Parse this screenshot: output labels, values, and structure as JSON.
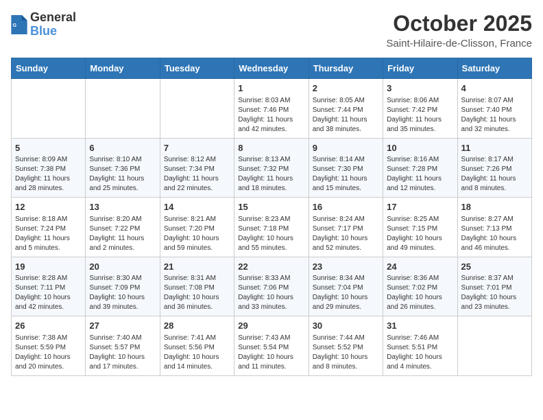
{
  "header": {
    "logo_general": "General",
    "logo_blue": "Blue",
    "month_title": "October 2025",
    "location": "Saint-Hilaire-de-Clisson, France"
  },
  "calendar": {
    "days_of_week": [
      "Sunday",
      "Monday",
      "Tuesday",
      "Wednesday",
      "Thursday",
      "Friday",
      "Saturday"
    ],
    "weeks": [
      [
        {
          "day": "",
          "info": ""
        },
        {
          "day": "",
          "info": ""
        },
        {
          "day": "",
          "info": ""
        },
        {
          "day": "1",
          "info": "Sunrise: 8:03 AM\nSunset: 7:46 PM\nDaylight: 11 hours\nand 42 minutes."
        },
        {
          "day": "2",
          "info": "Sunrise: 8:05 AM\nSunset: 7:44 PM\nDaylight: 11 hours\nand 38 minutes."
        },
        {
          "day": "3",
          "info": "Sunrise: 8:06 AM\nSunset: 7:42 PM\nDaylight: 11 hours\nand 35 minutes."
        },
        {
          "day": "4",
          "info": "Sunrise: 8:07 AM\nSunset: 7:40 PM\nDaylight: 11 hours\nand 32 minutes."
        }
      ],
      [
        {
          "day": "5",
          "info": "Sunrise: 8:09 AM\nSunset: 7:38 PM\nDaylight: 11 hours\nand 28 minutes."
        },
        {
          "day": "6",
          "info": "Sunrise: 8:10 AM\nSunset: 7:36 PM\nDaylight: 11 hours\nand 25 minutes."
        },
        {
          "day": "7",
          "info": "Sunrise: 8:12 AM\nSunset: 7:34 PM\nDaylight: 11 hours\nand 22 minutes."
        },
        {
          "day": "8",
          "info": "Sunrise: 8:13 AM\nSunset: 7:32 PM\nDaylight: 11 hours\nand 18 minutes."
        },
        {
          "day": "9",
          "info": "Sunrise: 8:14 AM\nSunset: 7:30 PM\nDaylight: 11 hours\nand 15 minutes."
        },
        {
          "day": "10",
          "info": "Sunrise: 8:16 AM\nSunset: 7:28 PM\nDaylight: 11 hours\nand 12 minutes."
        },
        {
          "day": "11",
          "info": "Sunrise: 8:17 AM\nSunset: 7:26 PM\nDaylight: 11 hours\nand 8 minutes."
        }
      ],
      [
        {
          "day": "12",
          "info": "Sunrise: 8:18 AM\nSunset: 7:24 PM\nDaylight: 11 hours\nand 5 minutes."
        },
        {
          "day": "13",
          "info": "Sunrise: 8:20 AM\nSunset: 7:22 PM\nDaylight: 11 hours\nand 2 minutes."
        },
        {
          "day": "14",
          "info": "Sunrise: 8:21 AM\nSunset: 7:20 PM\nDaylight: 10 hours\nand 59 minutes."
        },
        {
          "day": "15",
          "info": "Sunrise: 8:23 AM\nSunset: 7:18 PM\nDaylight: 10 hours\nand 55 minutes."
        },
        {
          "day": "16",
          "info": "Sunrise: 8:24 AM\nSunset: 7:17 PM\nDaylight: 10 hours\nand 52 minutes."
        },
        {
          "day": "17",
          "info": "Sunrise: 8:25 AM\nSunset: 7:15 PM\nDaylight: 10 hours\nand 49 minutes."
        },
        {
          "day": "18",
          "info": "Sunrise: 8:27 AM\nSunset: 7:13 PM\nDaylight: 10 hours\nand 46 minutes."
        }
      ],
      [
        {
          "day": "19",
          "info": "Sunrise: 8:28 AM\nSunset: 7:11 PM\nDaylight: 10 hours\nand 42 minutes."
        },
        {
          "day": "20",
          "info": "Sunrise: 8:30 AM\nSunset: 7:09 PM\nDaylight: 10 hours\nand 39 minutes."
        },
        {
          "day": "21",
          "info": "Sunrise: 8:31 AM\nSunset: 7:08 PM\nDaylight: 10 hours\nand 36 minutes."
        },
        {
          "day": "22",
          "info": "Sunrise: 8:33 AM\nSunset: 7:06 PM\nDaylight: 10 hours\nand 33 minutes."
        },
        {
          "day": "23",
          "info": "Sunrise: 8:34 AM\nSunset: 7:04 PM\nDaylight: 10 hours\nand 29 minutes."
        },
        {
          "day": "24",
          "info": "Sunrise: 8:36 AM\nSunset: 7:02 PM\nDaylight: 10 hours\nand 26 minutes."
        },
        {
          "day": "25",
          "info": "Sunrise: 8:37 AM\nSunset: 7:01 PM\nDaylight: 10 hours\nand 23 minutes."
        }
      ],
      [
        {
          "day": "26",
          "info": "Sunrise: 7:38 AM\nSunset: 5:59 PM\nDaylight: 10 hours\nand 20 minutes."
        },
        {
          "day": "27",
          "info": "Sunrise: 7:40 AM\nSunset: 5:57 PM\nDaylight: 10 hours\nand 17 minutes."
        },
        {
          "day": "28",
          "info": "Sunrise: 7:41 AM\nSunset: 5:56 PM\nDaylight: 10 hours\nand 14 minutes."
        },
        {
          "day": "29",
          "info": "Sunrise: 7:43 AM\nSunset: 5:54 PM\nDaylight: 10 hours\nand 11 minutes."
        },
        {
          "day": "30",
          "info": "Sunrise: 7:44 AM\nSunset: 5:52 PM\nDaylight: 10 hours\nand 8 minutes."
        },
        {
          "day": "31",
          "info": "Sunrise: 7:46 AM\nSunset: 5:51 PM\nDaylight: 10 hours\nand 4 minutes."
        },
        {
          "day": "",
          "info": ""
        }
      ]
    ]
  }
}
